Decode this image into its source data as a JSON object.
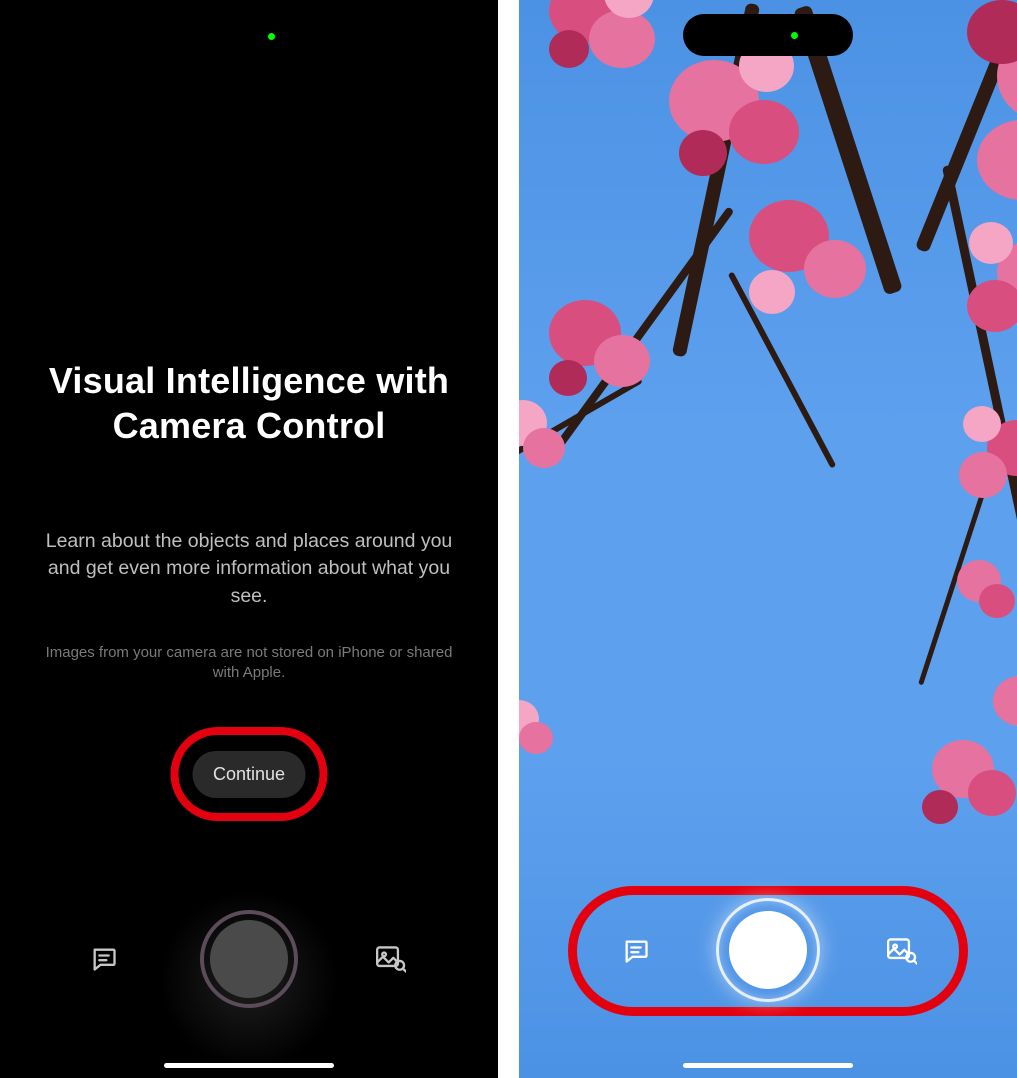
{
  "left": {
    "title": "Visual Intelligence with Camera Control",
    "description": "Learn about the objects and places around you and get even more information about what you see.",
    "disclaimer": "Images from your camera are not stored on iPhone or shared with Apple.",
    "continue_label": "Continue",
    "icons": {
      "chat": "chat-bubble-icon",
      "search": "image-search-icon",
      "shutter": "shutter-button"
    },
    "annotation": "red-highlight-continue"
  },
  "right": {
    "scene": "cherry-blossom-branches-against-blue-sky",
    "icons": {
      "chat": "chat-bubble-icon",
      "search": "image-search-icon",
      "shutter": "shutter-button"
    },
    "annotation": "red-highlight-controls"
  },
  "colors": {
    "highlight": "#e3000f",
    "sky": "#5da0ee",
    "blossom": "#e672a0"
  }
}
